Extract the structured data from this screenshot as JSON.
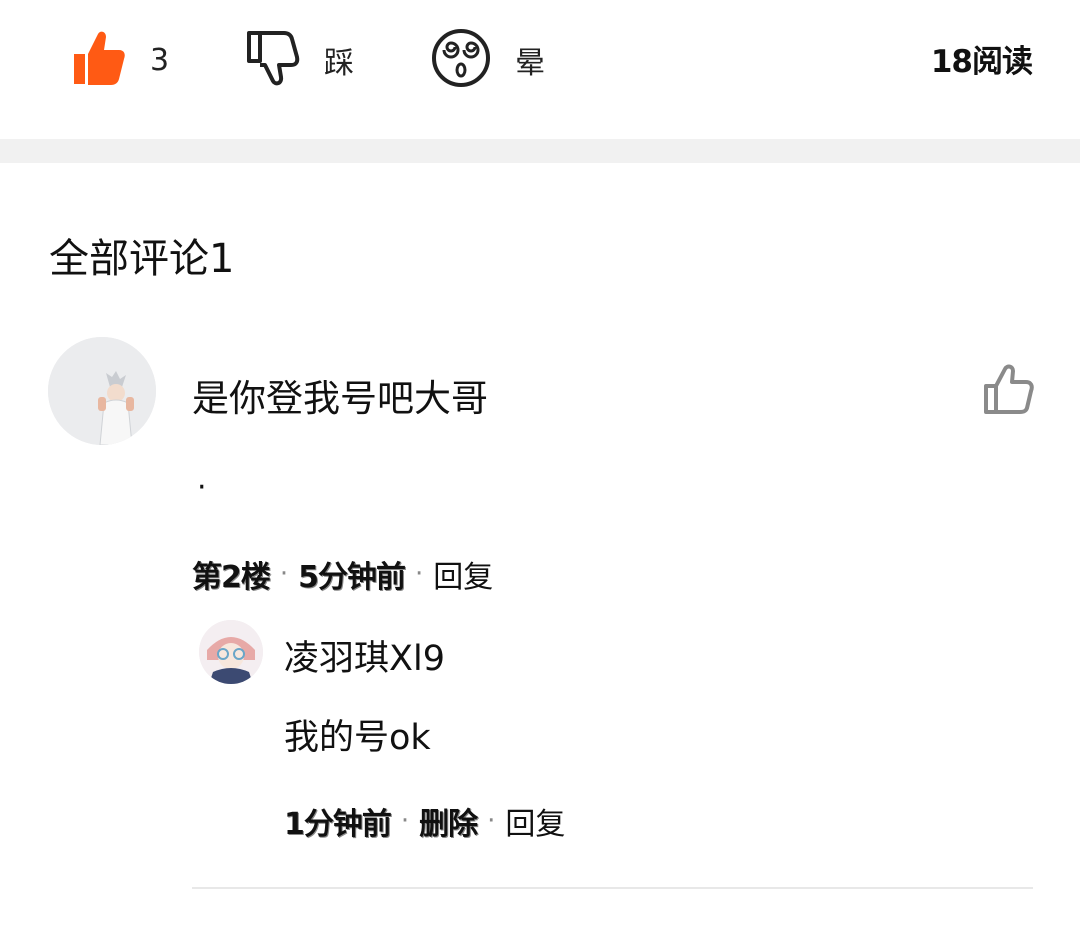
{
  "reactions": {
    "like": {
      "count": "3",
      "color": "#ff5a14",
      "icon": "thumbs-up-filled-icon"
    },
    "dislike": {
      "label": "踩",
      "icon": "thumbs-down-icon"
    },
    "dizzy": {
      "label": "晕",
      "icon": "dizzy-face-icon"
    },
    "reads": "18阅读"
  },
  "comments_section": {
    "heading": "全部评论1"
  },
  "comment": {
    "text": "是你登我号吧大哥",
    "extra": "·",
    "floor": "第2楼",
    "time": "5分钟前",
    "reply_label": "回复",
    "like_icon": "thumbs-up-outline-icon"
  },
  "reply": {
    "username": "凌羽琪Xl9",
    "text": "我的号ok",
    "time": "1分钟前",
    "delete_label": "删除",
    "reply_label": "回复"
  }
}
